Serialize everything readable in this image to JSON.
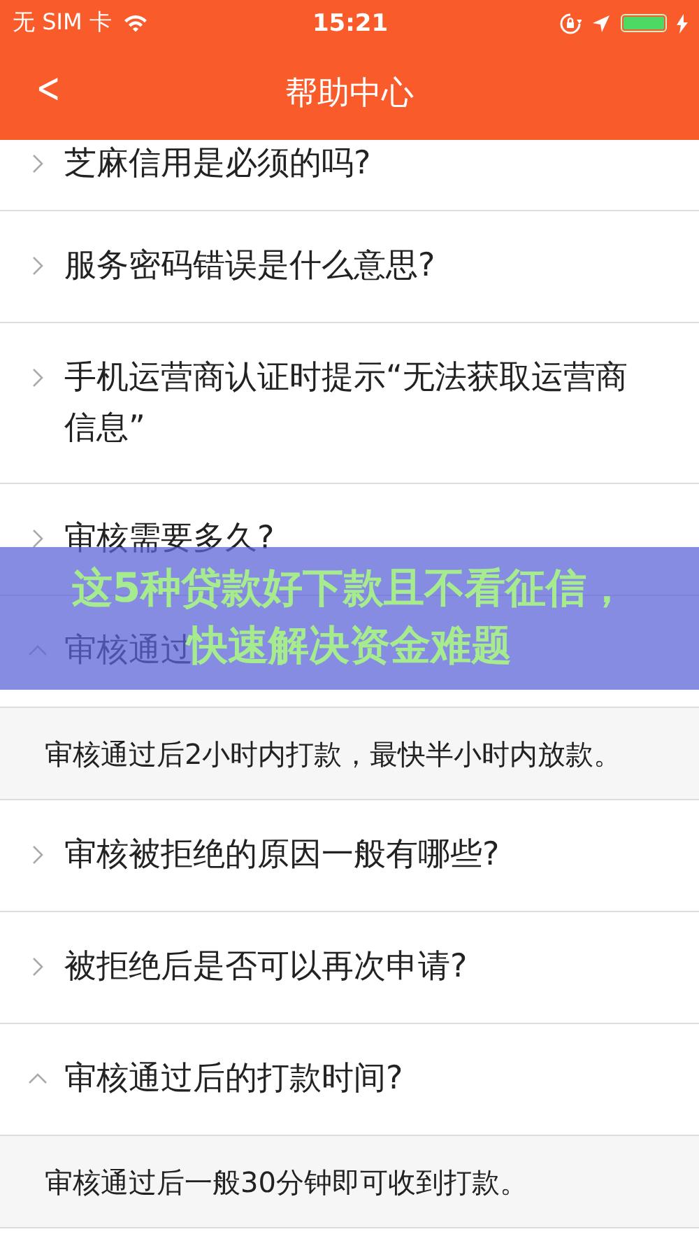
{
  "status_bar": {
    "carrier": "无 SIM 卡",
    "time": "15:21",
    "charging": true
  },
  "nav": {
    "back": "<",
    "title": "帮助中心"
  },
  "faq": [
    {
      "question": "芝麻信用是必须的吗?",
      "expanded": false
    },
    {
      "question": "服务密码错误是什么意思?",
      "expanded": false
    },
    {
      "question": "手机运营商认证时提示“无法获取运营商信息”",
      "expanded": false
    },
    {
      "question": "审核需要多久?",
      "expanded": false
    },
    {
      "question": "审核通过",
      "expanded": true,
      "answer": "审核通过后2小时内打款，最快半小时内放款。"
    },
    {
      "question": "审核被拒绝的原因一般有哪些?",
      "expanded": false
    },
    {
      "question": "被拒绝后是否可以再次申请?",
      "expanded": false
    },
    {
      "question": "审核通过后的打款时间?",
      "expanded": true,
      "answer": "审核通过后一般30分钟即可收到打款。"
    }
  ],
  "banner": {
    "text": "这5种贷款好下款且不看征信，快速解决资金难题"
  }
}
